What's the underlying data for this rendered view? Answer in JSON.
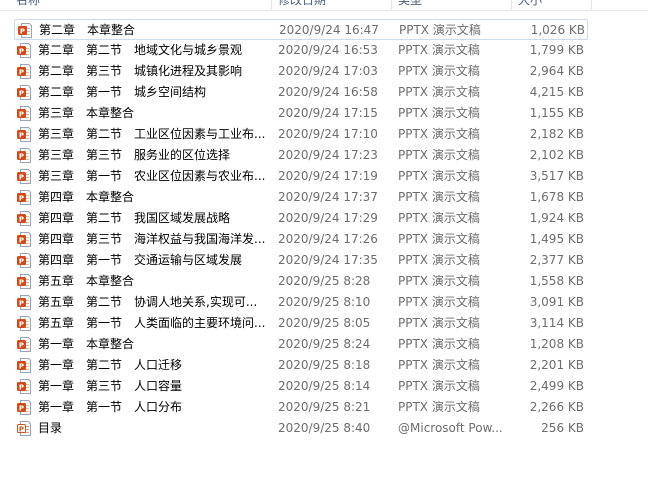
{
  "header": {
    "name": "名称",
    "date": "修改日期",
    "type": "类型",
    "size": "大小"
  },
  "files": [
    {
      "name": "第二章　本章整合",
      "date": "2020/9/24 16:47",
      "type": "PPTX 演示文稿",
      "size": "1,026 KB",
      "icon": "pptx-file-icon",
      "selected": true
    },
    {
      "name": "第二章　第二节　地域文化与城乡景观",
      "date": "2020/9/24 16:53",
      "type": "PPTX 演示文稿",
      "size": "1,799 KB",
      "icon": "pptx-file-icon"
    },
    {
      "name": "第二章　第三节　城镇化进程及其影响",
      "date": "2020/9/24 17:03",
      "type": "PPTX 演示文稿",
      "size": "2,964 KB",
      "icon": "pptx-file-icon"
    },
    {
      "name": "第二章　第一节　城乡空间结构",
      "date": "2020/9/24 16:58",
      "type": "PPTX 演示文稿",
      "size": "4,215 KB",
      "icon": "pptx-file-icon"
    },
    {
      "name": "第三章　本章整合",
      "date": "2020/9/24 17:15",
      "type": "PPTX 演示文稿",
      "size": "1,155 KB",
      "icon": "pptx-file-icon"
    },
    {
      "name": "第三章　第二节　工业区位因素与工业布...",
      "date": "2020/9/24 17:10",
      "type": "PPTX 演示文稿",
      "size": "2,182 KB",
      "icon": "pptx-file-icon"
    },
    {
      "name": "第三章　第三节　服务业的区位选择",
      "date": "2020/9/24 17:23",
      "type": "PPTX 演示文稿",
      "size": "2,102 KB",
      "icon": "pptx-file-icon"
    },
    {
      "name": "第三章　第一节　农业区位因素与农业布...",
      "date": "2020/9/24 17:19",
      "type": "PPTX 演示文稿",
      "size": "3,517 KB",
      "icon": "pptx-file-icon"
    },
    {
      "name": "第四章　本章整合",
      "date": "2020/9/24 17:37",
      "type": "PPTX 演示文稿",
      "size": "1,678 KB",
      "icon": "pptx-file-icon"
    },
    {
      "name": "第四章　第二节　我国区域发展战略",
      "date": "2020/9/24 17:29",
      "type": "PPTX 演示文稿",
      "size": "1,924 KB",
      "icon": "pptx-file-icon"
    },
    {
      "name": "第四章　第三节　海洋权益与我国海洋发...",
      "date": "2020/9/24 17:26",
      "type": "PPTX 演示文稿",
      "size": "1,495 KB",
      "icon": "pptx-file-icon"
    },
    {
      "name": "第四章　第一节　交通运输与区域发展",
      "date": "2020/9/24 17:35",
      "type": "PPTX 演示文稿",
      "size": "2,377 KB",
      "icon": "pptx-file-icon"
    },
    {
      "name": "第五章　本章整合",
      "date": "2020/9/25 8:28",
      "type": "PPTX 演示文稿",
      "size": "1,558 KB",
      "icon": "pptx-file-icon"
    },
    {
      "name": "第五章　第二节　协调人地关系,实现可...",
      "date": "2020/9/25 8:10",
      "type": "PPTX 演示文稿",
      "size": "3,091 KB",
      "icon": "pptx-file-icon"
    },
    {
      "name": "第五章　第一节　人类面临的主要环境问...",
      "date": "2020/9/25 8:05",
      "type": "PPTX 演示文稿",
      "size": "3,114 KB",
      "icon": "pptx-file-icon"
    },
    {
      "name": "第一章　本章整合",
      "date": "2020/9/25 8:24",
      "type": "PPTX 演示文稿",
      "size": "1,208 KB",
      "icon": "pptx-file-icon"
    },
    {
      "name": "第一章　第二节　人口迁移",
      "date": "2020/9/25 8:18",
      "type": "PPTX 演示文稿",
      "size": "2,201 KB",
      "icon": "pptx-file-icon"
    },
    {
      "name": "第一章　第三节　人口容量",
      "date": "2020/9/25 8:14",
      "type": "PPTX 演示文稿",
      "size": "2,499 KB",
      "icon": "pptx-file-icon"
    },
    {
      "name": "第一章　第一节　人口分布",
      "date": "2020/9/25 8:21",
      "type": "PPTX 演示文稿",
      "size": "2,266 KB",
      "icon": "pptx-file-icon"
    },
    {
      "name": "目录",
      "date": "2020/9/25 8:40",
      "type": "@Microsoft Pow...",
      "size": "256 KB",
      "icon": "ppt-file-icon"
    }
  ],
  "colors": {
    "pptx_icon": "#d04a1c",
    "ppt_icon": "#c8571e",
    "selection_border": "#cddbee",
    "header_text": "#4c607a",
    "meta_text": "#6d6d6d"
  }
}
